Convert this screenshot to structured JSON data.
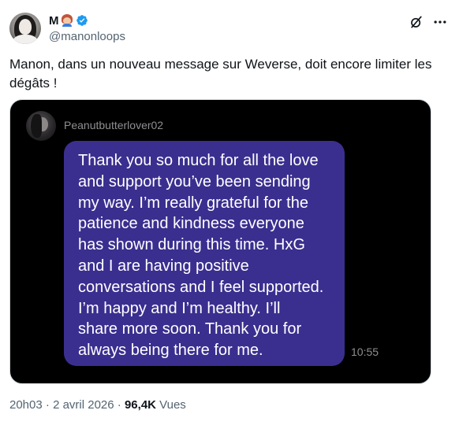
{
  "author": {
    "display_name": "M",
    "handle": "@manonloops",
    "verified": true,
    "emoji_icon": "woman-red-hair-emoji-icon"
  },
  "icons": {
    "grok": "grok-icon",
    "more": "more-icon",
    "verified": "verified-badge-icon"
  },
  "tweet": {
    "text": "Manon, dans un nouveau message sur Weverse, doit encore limiter les dégâts !"
  },
  "media": {
    "chat_username": "Peanutbutterlover02",
    "message": "Thank you so much for all the love\nand support you’ve been sending\nmy way. I’m really grateful for the\npatience and kindness everyone\nhas shown during this time.  HxG\nand I are having positive\nconversations and I feel supported.\nI’m happy and I’m healthy.  I’ll\nshare more soon. Thank you for\nalways being there for me.",
    "time": "10:55"
  },
  "meta": {
    "time": "20h03",
    "date": "2 avril 2026",
    "separator": "·",
    "views_count": "96,4K",
    "views_label": "Vues"
  },
  "colors": {
    "bubble": "#3a2f8f",
    "verified_blue": "#1d9bf0",
    "text_primary": "#0f1419",
    "text_secondary": "#536471"
  }
}
